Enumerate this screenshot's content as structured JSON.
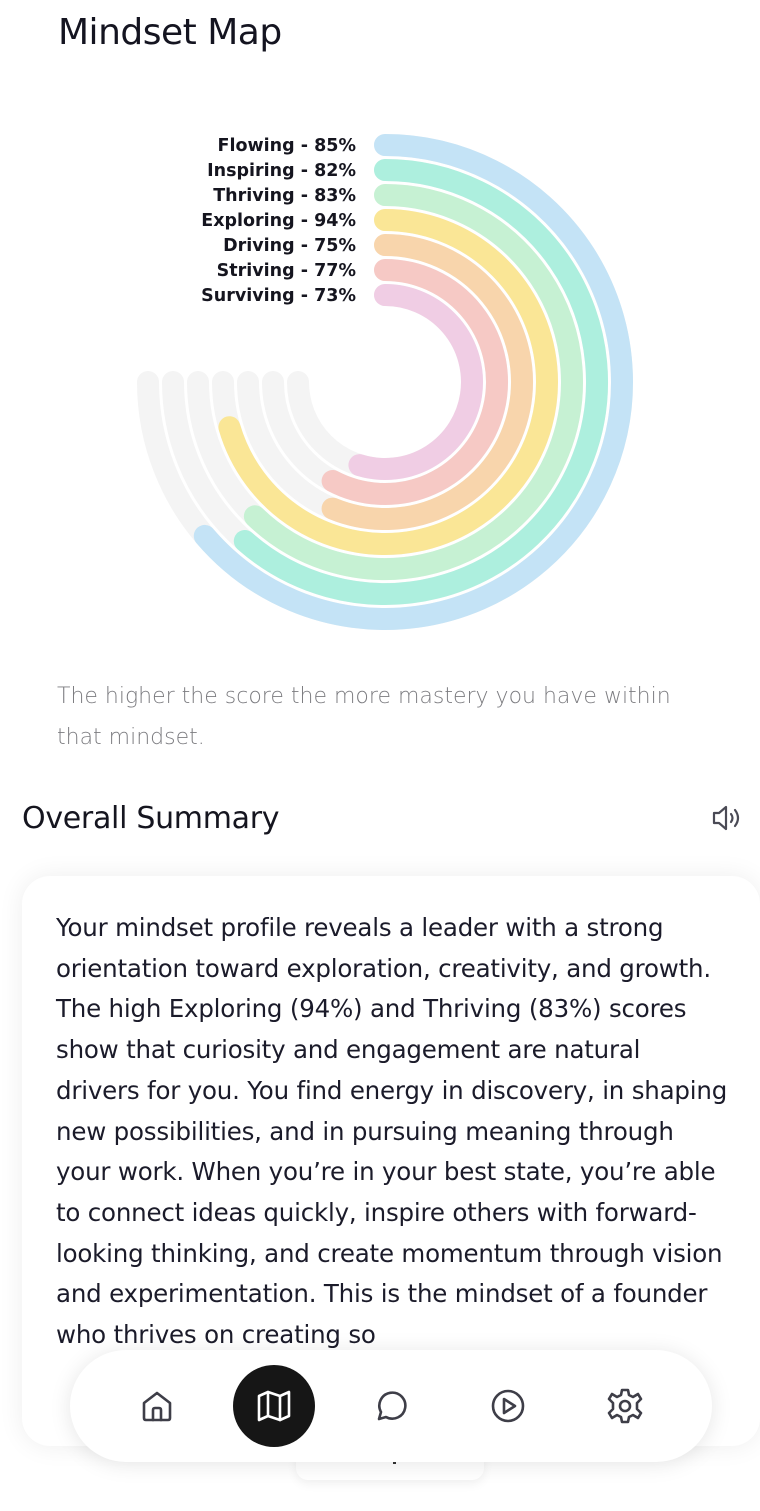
{
  "page": {
    "title": "Mindset Map",
    "caption": "The higher the score the more mastery you have within that mindset."
  },
  "chart_data": {
    "type": "radial-bar",
    "series": [
      {
        "name": "Flowing",
        "value": 85,
        "label": "Flowing - 85%",
        "color": "#c4e3f6"
      },
      {
        "name": "Inspiring",
        "value": 82,
        "label": "Inspiring - 82%",
        "color": "#adefde"
      },
      {
        "name": "Thriving",
        "value": 83,
        "label": "Thriving - 83%",
        "color": "#c6f1d3"
      },
      {
        "name": "Exploring",
        "value": 94,
        "label": "Exploring - 94%",
        "color": "#fae696"
      },
      {
        "name": "Driving",
        "value": 75,
        "label": "Driving - 75%",
        "color": "#f8d5ac"
      },
      {
        "name": "Striving",
        "value": 77,
        "label": "Striving - 77%",
        "color": "#f6c9c5"
      },
      {
        "name": "Surviving",
        "value": 73,
        "label": "Surviving - 73%",
        "color": "#f0cde4"
      }
    ],
    "max": 100,
    "track_color": "#f4f4f4"
  },
  "summary": {
    "title": "Overall Summary",
    "text": "Your mindset profile reveals a leader with a strong orientation toward exploration, creativity, and growth. The high Exploring (94%) and Thriving (83%) scores show that curiosity and engagement are natural drivers for you. You find energy in discovery, in shaping new possibilities, and in pursuing meaning through your work. When you’re in your best state, you’re able to connect ideas quickly, inspire others with forward-looking thinking, and create momentum through vision and experimentation. This is the mindset of a founder who thrives on creating so"
  },
  "icons": {
    "speaker": "speaker-icon",
    "home": "home-icon",
    "map": "map-icon",
    "chat": "chat-bubble-icon",
    "play": "play-icon",
    "settings": "gear-icon"
  },
  "colors": {
    "nav_active": "#161616",
    "text_primary": "#15151f",
    "caption": "#7c7c80"
  }
}
